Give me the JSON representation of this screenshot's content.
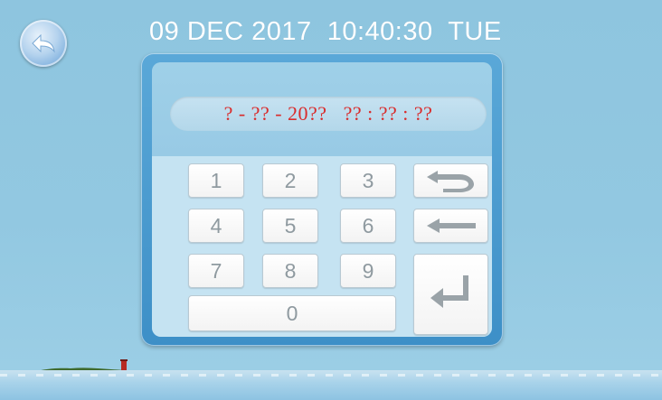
{
  "header": {
    "datetime": "09 DEC 2017  10:40:30  TUE",
    "back_icon": "back-arrow-icon"
  },
  "editor": {
    "datetime_value": "? - ?? - 20??   ?? : ?? : ??"
  },
  "keypad": {
    "keys": [
      "1",
      "2",
      "3",
      "4",
      "5",
      "6",
      "7",
      "8",
      "9",
      "0"
    ],
    "undo_icon": "undo-icon",
    "backspace_icon": "backspace-arrow-icon",
    "enter_icon": "enter-icon"
  },
  "colors": {
    "background": "#8ec3dd",
    "panel_border": "#3d8fc7",
    "datetime_text": "#d92c2c",
    "key_text": "#8f9aa0"
  }
}
